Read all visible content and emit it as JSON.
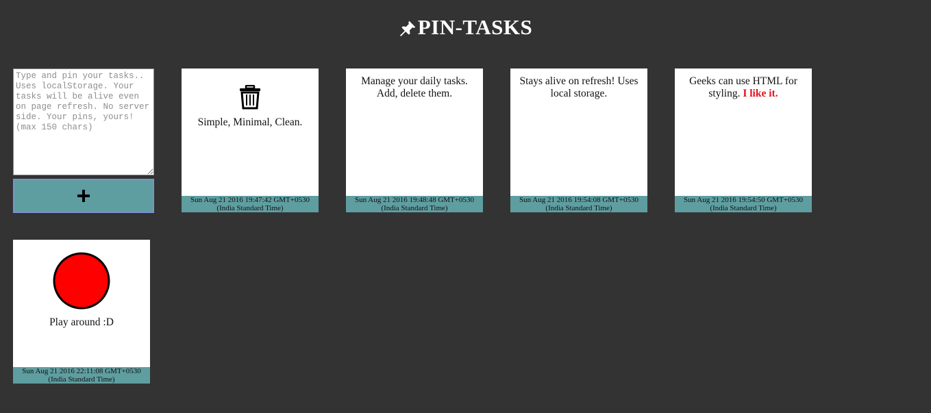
{
  "header": {
    "title": "PIN-TASKS",
    "icon": "pushpin-icon"
  },
  "composer": {
    "placeholder": "Type and pin your tasks.. Uses localStorage. Your tasks will be alive even on page refresh. No server side. Your pins, yours! (max 150 chars)",
    "value": "",
    "add_icon": "plus-icon"
  },
  "colors": {
    "background": "#333333",
    "accent": "#5f9ea0",
    "highlight": "#e0141e",
    "circle": "#ff0000"
  },
  "cards": [
    {
      "icon": "trash-icon",
      "text": "Simple, Minimal, Clean.",
      "stamp_line1": "Sun Aug 21 2016 19:47:42 GMT+0530",
      "stamp_line2": "(India Standard Time)"
    },
    {
      "text": "Manage your daily tasks. Add, delete them.",
      "stamp_line1": "Sun Aug 21 2016 19:48:48 GMT+0530",
      "stamp_line2": "(India Standard Time)"
    },
    {
      "text": "Stays alive on refresh! Uses local storage.",
      "stamp_line1": "Sun Aug 21 2016 19:54:08 GMT+0530",
      "stamp_line2": "(India Standard Time)"
    },
    {
      "text": "Geeks can use HTML for styling.",
      "highlight": "I like it.",
      "stamp_line1": "Sun Aug 21 2016 19:54:50 GMT+0530",
      "stamp_line2": "(India Standard Time)"
    },
    {
      "icon": "red-circle-icon",
      "text": "Play around :D",
      "stamp_line1": "Sun Aug 21 2016 22:11:08 GMT+0530",
      "stamp_line2": "(India Standard Time)"
    }
  ]
}
